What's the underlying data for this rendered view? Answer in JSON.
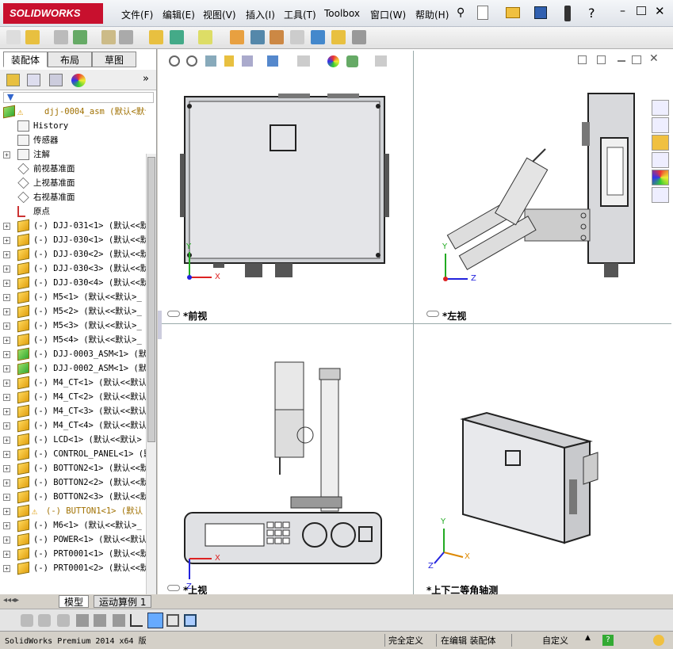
{
  "app": {
    "logo": "SOLIDWORKS"
  },
  "menu": [
    "文件(F)",
    "编辑(E)",
    "视图(V)",
    "插入(I)",
    "工具(T)",
    "Toolbox",
    "窗口(W)",
    "帮助(H)"
  ],
  "panel": {
    "tabs": [
      "装配体",
      "布局",
      "草图"
    ],
    "tree": [
      {
        "label": "djj-0004_asm  (默认<默认>",
        "warn": true,
        "root": true
      },
      {
        "label": "History",
        "icon": "history"
      },
      {
        "label": "传感器",
        "icon": "sensor"
      },
      {
        "label": "注解",
        "icon": "annotation",
        "expand": true
      },
      {
        "label": "前视基准面",
        "icon": "plane"
      },
      {
        "label": "上视基准面",
        "icon": "plane"
      },
      {
        "label": "右视基准面",
        "icon": "plane"
      },
      {
        "label": "原点",
        "icon": "origin"
      },
      {
        "label": "(-) DJJ-031<1> (默认<<默",
        "icon": "part",
        "expand": true
      },
      {
        "label": "(-) DJJ-030<1> (默认<<默",
        "icon": "part",
        "expand": true
      },
      {
        "label": "(-) DJJ-030<2> (默认<<默",
        "icon": "part",
        "expand": true
      },
      {
        "label": "(-) DJJ-030<3> (默认<<默",
        "icon": "part",
        "expand": true
      },
      {
        "label": "(-) DJJ-030<4> (默认<<默",
        "icon": "part",
        "expand": true
      },
      {
        "label": "(-) M5<1> (默认<<默认>_",
        "icon": "part",
        "expand": true
      },
      {
        "label": "(-) M5<2> (默认<<默认>_",
        "icon": "part",
        "expand": true
      },
      {
        "label": "(-) M5<3> (默认<<默认>_",
        "icon": "part",
        "expand": true
      },
      {
        "label": "(-) M5<4> (默认<<默认>_",
        "icon": "part",
        "expand": true
      },
      {
        "label": "(-) DJJ-0003_ASM<1> (默",
        "icon": "asm",
        "expand": true
      },
      {
        "label": "(-) DJJ-0002_ASM<1> (默",
        "icon": "asm",
        "expand": true
      },
      {
        "label": "(-) M4_CT<1> (默认<<默认",
        "icon": "part",
        "expand": true
      },
      {
        "label": "(-) M4_CT<2> (默认<<默认",
        "icon": "part",
        "expand": true
      },
      {
        "label": "(-) M4_CT<3> (默认<<默认",
        "icon": "part",
        "expand": true
      },
      {
        "label": "(-) M4_CT<4> (默认<<默认",
        "icon": "part",
        "expand": true
      },
      {
        "label": "(-) LCD<1> (默认<<默认>",
        "icon": "part",
        "expand": true
      },
      {
        "label": "(-) CONTROL_PANEL<1> (默",
        "icon": "part",
        "expand": true
      },
      {
        "label": "(-) BOTTON2<1> (默认<<默",
        "icon": "part",
        "expand": true
      },
      {
        "label": "(-) BOTTON2<2> (默认<<默",
        "icon": "part",
        "expand": true
      },
      {
        "label": "(-) BOTTON2<3> (默认<<默",
        "icon": "part",
        "expand": true
      },
      {
        "label": "(-) BUTTON1<1> (默认",
        "icon": "part",
        "expand": true,
        "warn": true
      },
      {
        "label": "(-) M6<1> (默认<<默认>_",
        "icon": "part",
        "expand": true
      },
      {
        "label": "(-) POWER<1> (默认<<默认",
        "icon": "part",
        "expand": true
      },
      {
        "label": "(-) PRT0001<1> (默认<<默",
        "icon": "part",
        "expand": true
      },
      {
        "label": "(-) PRT0001<2> (默认<<默",
        "icon": "part",
        "expand": true
      }
    ]
  },
  "views": {
    "front": "*前视",
    "left": "*左视",
    "top": "*上视",
    "iso": "*上下二等角轴测"
  },
  "axes": {
    "x": "X",
    "y": "Y",
    "z": "Z"
  },
  "bottom_tabs": [
    "模型",
    "运动算例 1"
  ],
  "status": {
    "product": "SolidWorks Premium 2014 x64 版",
    "defined": "完全定义",
    "editing": "在编辑 装配体",
    "custom": "自定义"
  },
  "colors": {
    "brand": "#c8102e",
    "axis_x": "#d22",
    "axis_y": "#2a2",
    "axis_z": "#22d"
  }
}
